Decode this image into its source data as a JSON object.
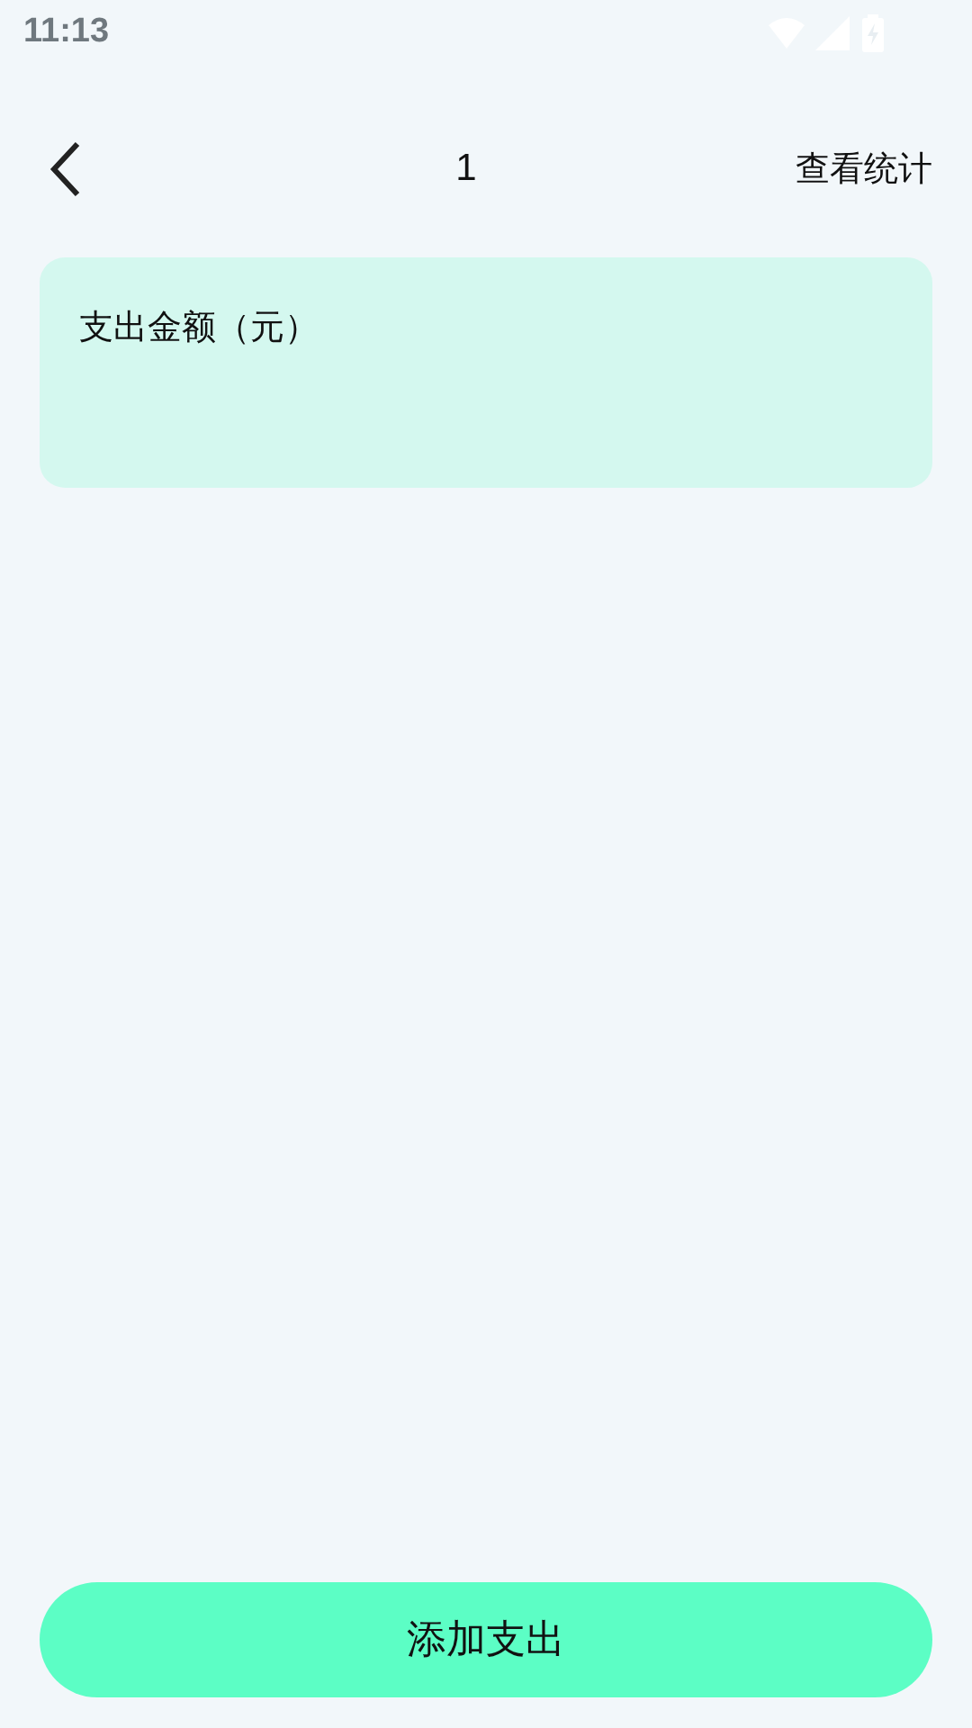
{
  "status_bar": {
    "time": "11:13"
  },
  "header": {
    "title": "1",
    "action": "查看统计"
  },
  "amount_card": {
    "label": "支出金额（元）"
  },
  "primary_button": {
    "label": "添加支出"
  }
}
